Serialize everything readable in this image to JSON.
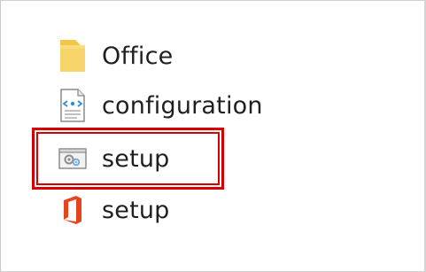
{
  "files": [
    {
      "name": "Office",
      "icon": "folder-icon"
    },
    {
      "name": "configuration",
      "icon": "xml-document-icon"
    },
    {
      "name": "setup",
      "icon": "settings-file-icon",
      "highlighted": true
    },
    {
      "name": "setup",
      "icon": "office-logo-icon"
    }
  ],
  "colors": {
    "highlight": "#d60000",
    "folder": "#f5c842",
    "office": "#e8431f"
  }
}
